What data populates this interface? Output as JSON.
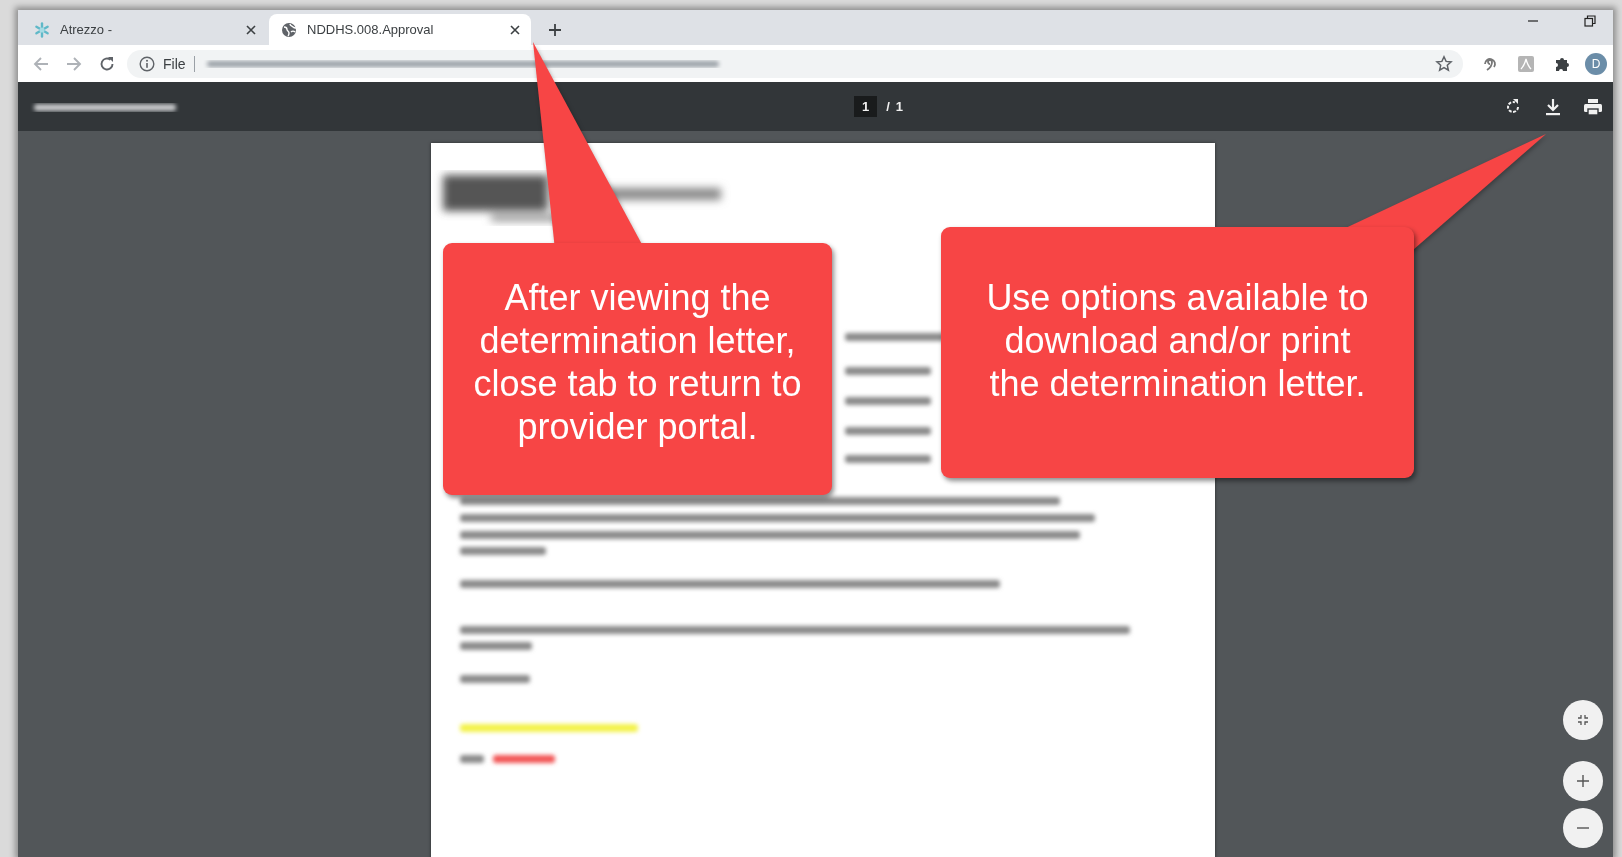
{
  "browser": {
    "tabs": [
      {
        "kind": "asterisk",
        "title": "Atrezzo -",
        "selected": false
      },
      {
        "kind": "globe",
        "title": "NDDHS.008.Approval",
        "selected": true
      }
    ],
    "address": {
      "scheme_label": "File"
    },
    "profile_initial": "D"
  },
  "pdf_viewer": {
    "page_input": "1",
    "page_separator": "/",
    "page_count": "1"
  },
  "callouts": [
    {
      "text": "After viewing the determination letter, close tab to return to provider portal."
    },
    {
      "text": "Use options available to download and/or print the determination letter."
    }
  ]
}
